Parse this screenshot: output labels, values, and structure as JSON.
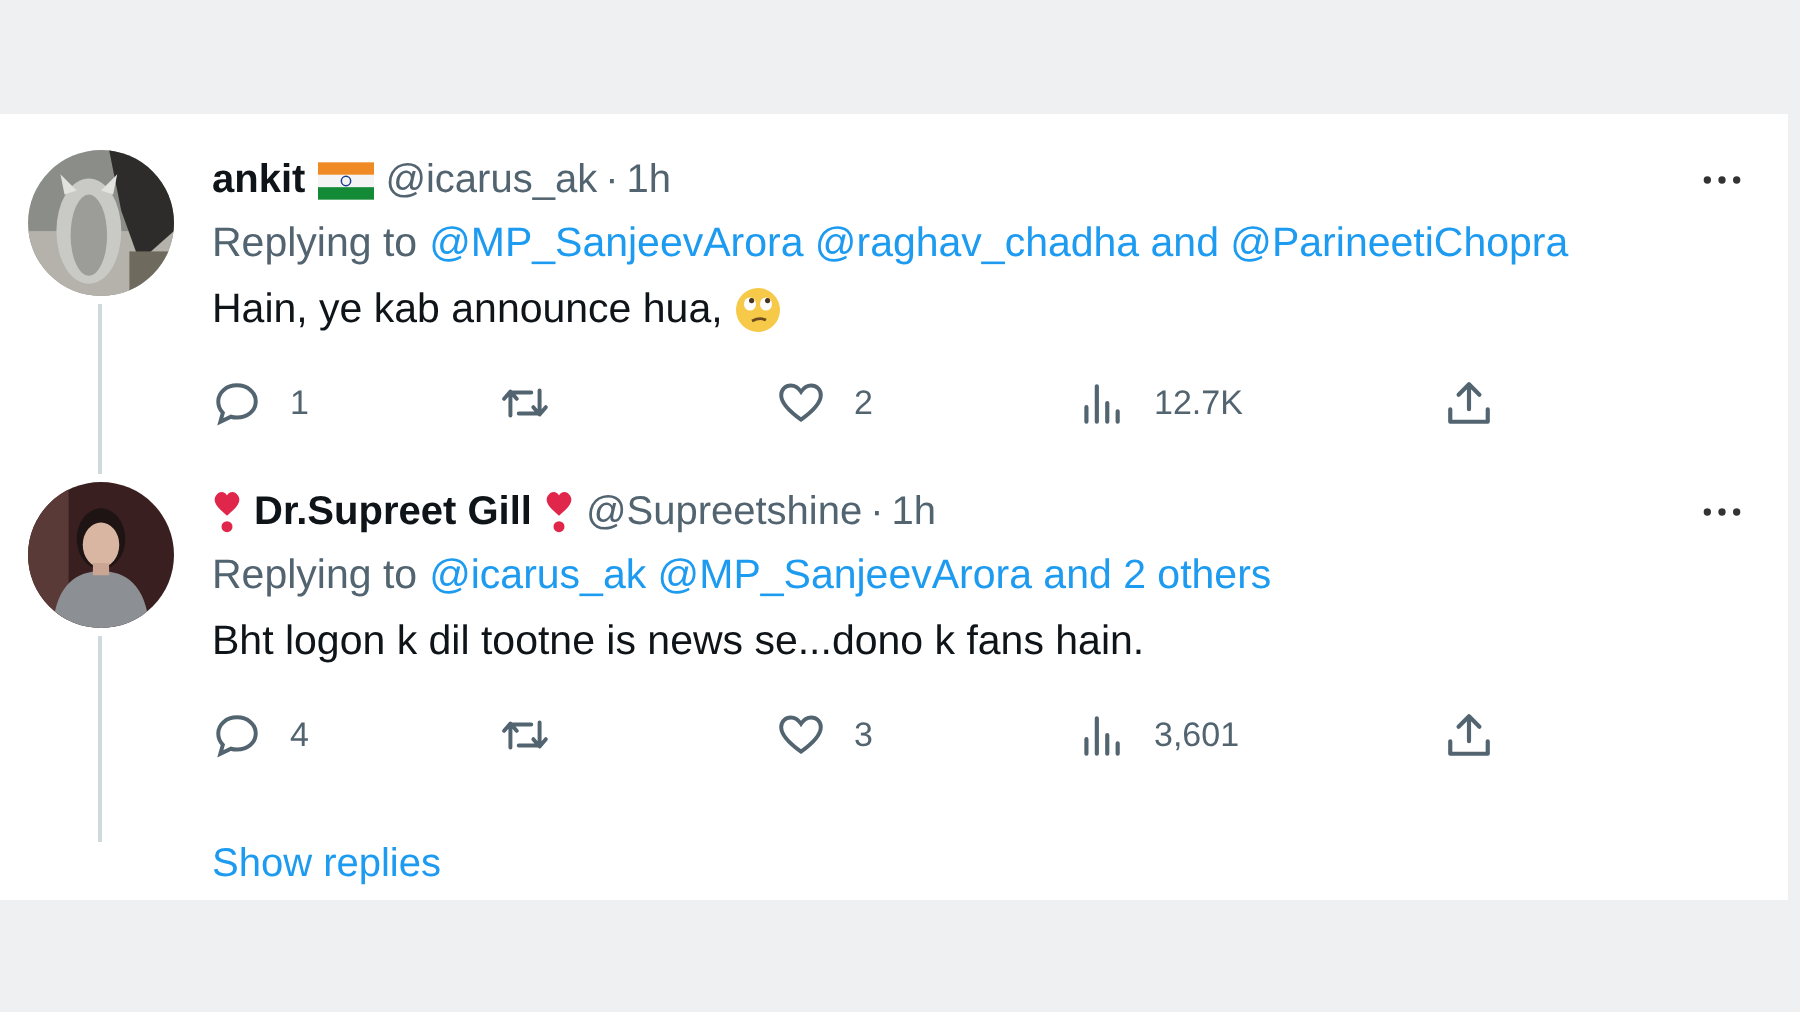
{
  "tweets": [
    {
      "heart_emojis": false,
      "name": "ankit",
      "flag_emoji": true,
      "handle": "@icarus_ak",
      "separator": "·",
      "time": "1h",
      "replying_label": "Replying to",
      "replying_to": "@MP_SanjeevArora @raghav_chadha and @ParineetiChopra",
      "text": "Hain, ye kab announce hua,",
      "rolling_eyes_emoji": true,
      "actions": [
        {
          "kind": "reply",
          "count": "1"
        },
        {
          "kind": "retweet"
        },
        {
          "kind": "like",
          "count": "2"
        },
        {
          "kind": "views",
          "count": "12.7K"
        },
        {
          "kind": "share"
        }
      ]
    },
    {
      "heart_emojis": true,
      "name": "Dr.Supreet Gill",
      "flag_emoji": false,
      "handle": "@Supreetshine",
      "separator": "·",
      "time": "1h",
      "replying_label": "Replying to",
      "replying_to": "@icarus_ak @MP_SanjeevArora and 2 others",
      "text": "Bht logon k dil tootne is news se...dono k fans hain.",
      "rolling_eyes_emoji": false,
      "actions": [
        {
          "kind": "reply",
          "count": "4"
        },
        {
          "kind": "retweet"
        },
        {
          "kind": "like",
          "count": "3"
        },
        {
          "kind": "views",
          "count": "3,601"
        },
        {
          "kind": "share"
        }
      ]
    }
  ],
  "show_replies": "Show replies"
}
